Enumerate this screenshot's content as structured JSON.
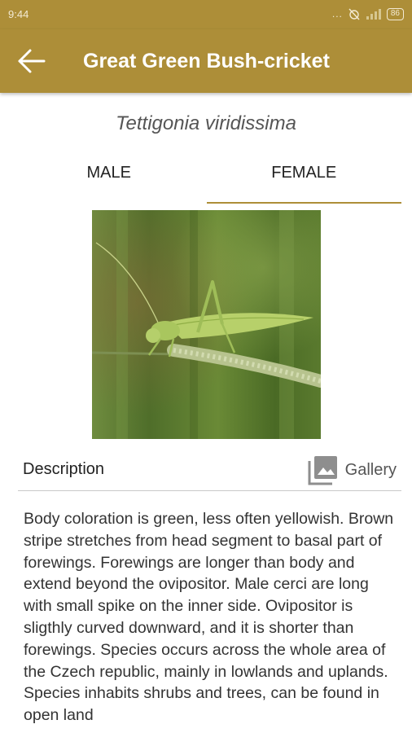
{
  "status": {
    "time": "9:44",
    "dots": "...",
    "battery": "86"
  },
  "header": {
    "title": "Great Green Bush-cricket"
  },
  "scientific_name": "Tettigonia viridissima",
  "tabs": [
    {
      "label": "MALE"
    },
    {
      "label": "FEMALE"
    }
  ],
  "selected_tab": "FEMALE",
  "description": {
    "heading": "Description",
    "gallery_label": "Gallery",
    "text": "Body coloration is green, less often yellowish. Brown stripe stretches from head segment to basal part of forewings. Forewings are longer than body and extend beyond the ovipositor. Male cerci are long with small spike on the inner side. Ovipositor is sligthly curved downward, and it is shorter than forewings. Species occurs across the whole area of the Czech republic, mainly in lowlands and uplands. Species inhabits shrubs and trees, can be found in open land"
  },
  "colors": {
    "accent": "#ad8e38"
  }
}
